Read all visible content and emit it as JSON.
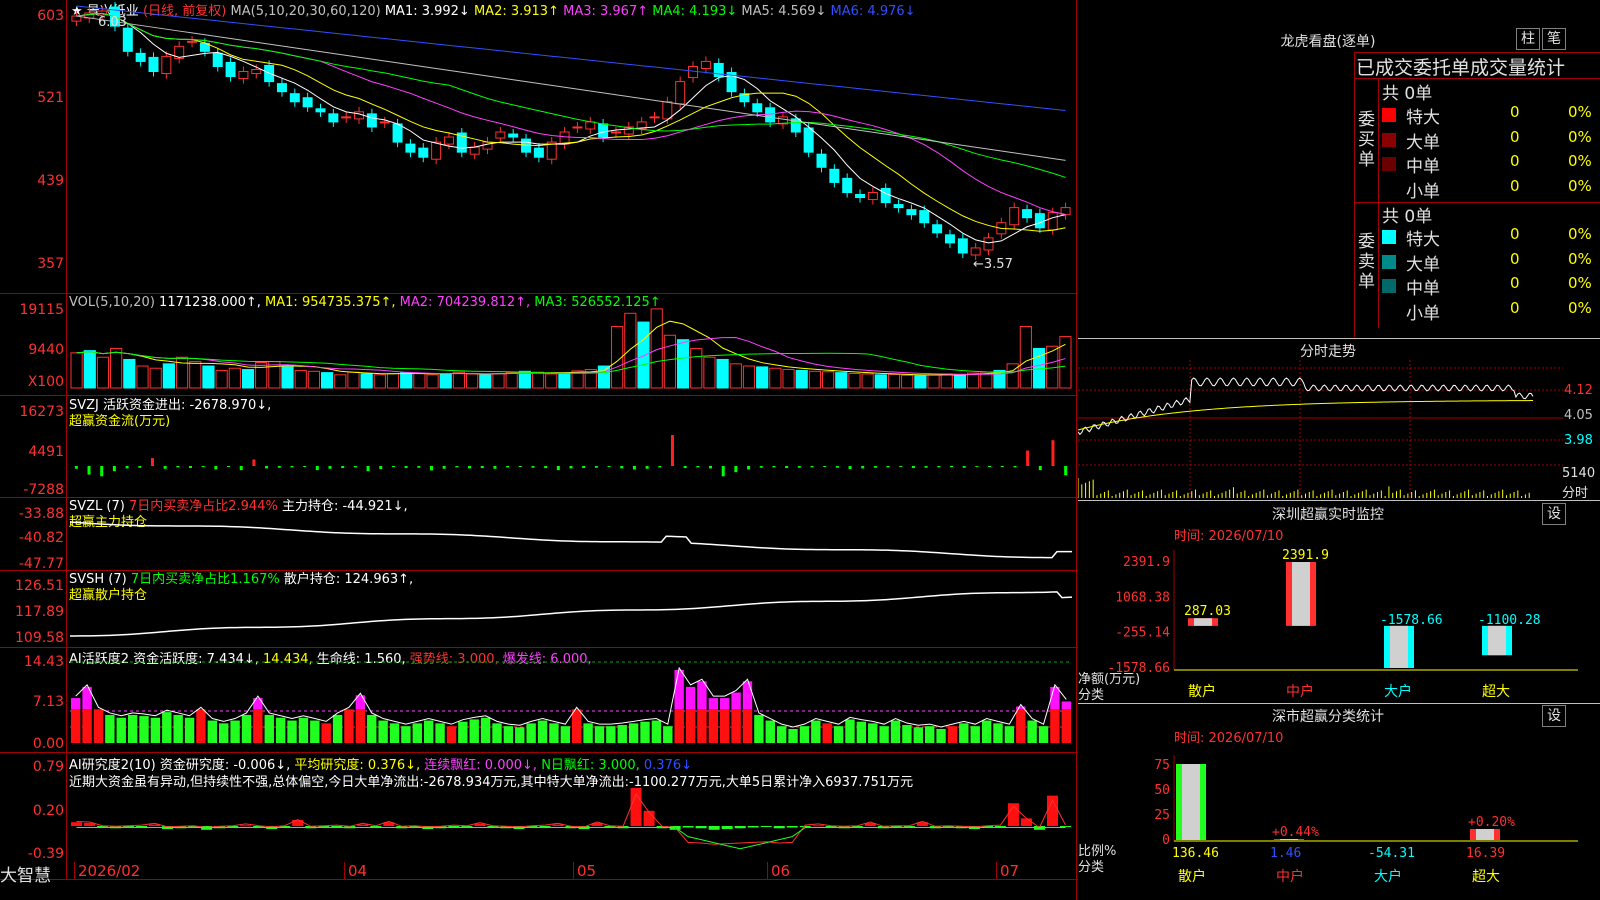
{
  "stock": {
    "star": "★",
    "name": "景兴纸业",
    "period": "(日线, 前复权)"
  },
  "main_header": [
    {
      "text": "MA(5,10,20,30,60,120)",
      "color": "#c0c0c0"
    },
    {
      "text": "MA1: 3.992↓",
      "color": "#ffffff"
    },
    {
      "text": "MA2: 3.913↑",
      "color": "#ffff00"
    },
    {
      "text": "MA3: 3.967↑",
      "color": "#ff40ff"
    },
    {
      "text": "MA4: 4.193↓",
      "color": "#00ff00"
    },
    {
      "text": "MA5: 4.569↓",
      "color": "#c0c0c0"
    },
    {
      "text": "MA6: 4.976↓",
      "color": "#3050ff"
    }
  ],
  "price_annotations": {
    "high": "6.03",
    "low": "←3.57"
  },
  "vol_header": [
    {
      "text": "VOL(5,10,20)",
      "color": "#c0c0c0"
    },
    {
      "text": "1171238.000↑,",
      "color": "#ffffff"
    },
    {
      "text": "MA1: 954735.375↑,",
      "color": "#ffff00"
    },
    {
      "text": "MA2: 704239.812↑,",
      "color": "#ff40ff"
    },
    {
      "text": "MA3: 526552.125↑",
      "color": "#00ff00"
    }
  ],
  "vol_unit": "X100",
  "svzj": {
    "l1": "SVZJ  活跃资金进出: -2678.970↓,",
    "l2": "超赢资金流(万元)"
  },
  "svzl": {
    "l1a": "SVZL (7)",
    "l1b": "7日内买卖净占比2.944%",
    "l1c": "主力持仓: -44.921↓,",
    "l2": "超赢主力持仓"
  },
  "svsh": {
    "l1a": "SVSH (7)",
    "l1b": "7日内买卖净占比1.167%",
    "l1c": "散户持仓: 124.963↑,",
    "l2": "超赢散户持仓"
  },
  "ai1": [
    {
      "text": "AI活跃度2 资金活跃度: 7.434↓,",
      "color": "#ffffff"
    },
    {
      "text": "14.434,",
      "color": "#ffff00"
    },
    {
      "text": "生命线: 1.560,",
      "color": "#ffffff"
    },
    {
      "text": "强势线: 3.000,",
      "color": "#ff3030"
    },
    {
      "text": "爆发线: 6.000,",
      "color": "#ff40ff"
    }
  ],
  "ai2": [
    {
      "text": "AI研究度2(10) 资金研究度: -0.006↓,",
      "color": "#ffffff"
    },
    {
      "text": "平均研究度: 0.376↓,",
      "color": "#ffff00"
    },
    {
      "text": "连续飘红: 0.000↓,",
      "color": "#ff40ff"
    },
    {
      "text": "N日飘红: 3.000,",
      "color": "#00ff00"
    },
    {
      "text": "0.376↓",
      "color": "#3050ff"
    }
  ],
  "ai2_note": "近期大资金虽有异动,但持续性不强,总体偏空,今日大单净流出:-2678.934万元,其中特大单净流出:-1100.277万元,大单5日累计净入6937.751万元",
  "y_labels": {
    "price": [
      "603",
      "521",
      "439",
      "357"
    ],
    "vol": [
      "19115",
      "9440"
    ],
    "svzj": [
      "16273",
      "4491",
      "-7288"
    ],
    "svzl": [
      "-33.88",
      "-40.82",
      "-47.77"
    ],
    "svsh": [
      "126.51",
      "117.89",
      "109.58"
    ],
    "ai1": [
      "14.43",
      "7.13",
      "0.00"
    ],
    "ai2": [
      "0.79",
      "0.20",
      "-0.39"
    ]
  },
  "x_labels": [
    "2026/02",
    "04",
    "05",
    "06",
    "07"
  ],
  "brand": "大智慧",
  "right": {
    "lhkp_title": "龙虎看盘(逐单)",
    "btn_zhu": "柱",
    "btn_bi": "笔",
    "table_title": "已成交委托单成交量统计",
    "buy_label": "委买单",
    "sell_label": "委卖单",
    "buy_total": "共 0单",
    "sell_total": "共 0单",
    "buy_rows": [
      {
        "name": "特大",
        "val": "0",
        "pct": "0%",
        "color": "#ff0000"
      },
      {
        "name": "大单",
        "val": "0",
        "pct": "0%",
        "color": "#8b0000"
      },
      {
        "name": "中单",
        "val": "0",
        "pct": "0%",
        "color": "#6a0000"
      },
      {
        "name": "小单",
        "val": "0",
        "pct": "0%",
        "color": "#000000"
      }
    ],
    "sell_rows": [
      {
        "name": "特大",
        "val": "0",
        "pct": "0%",
        "color": "#00ffff"
      },
      {
        "name": "大单",
        "val": "0",
        "pct": "0%",
        "color": "#008b8b"
      },
      {
        "name": "中单",
        "val": "0",
        "pct": "0%",
        "color": "#006a6a"
      },
      {
        "name": "小单",
        "val": "0",
        "pct": "0%",
        "color": "#000000"
      }
    ],
    "intraday_title": "分时走势",
    "intraday_labels": [
      "4.12",
      "4.05",
      "3.98"
    ],
    "intraday_vol": "5140",
    "intraday_unit": "分时",
    "monitor_title": "深圳超赢实时监控",
    "btn_set": "设",
    "monitor_date": "时间: 2026/07/10",
    "monitor_ylabels": [
      "2391.9",
      "1068.38",
      "-255.14",
      "-1578.66"
    ],
    "monitor_axis": "净额(万元)",
    "monitor_axis2": "分类",
    "cats": [
      "散户",
      "中户",
      "大户",
      "超大"
    ],
    "stat_title": "深市超赢分类统计",
    "stat_date": "时间: 2026/07/10",
    "stat_ylabels": [
      "75",
      "50",
      "25",
      "0"
    ],
    "stat_axis": "比例%",
    "stat_axis2": "分类"
  },
  "chart_data": [
    {
      "type": "candlestick",
      "title": "景兴纸业 (日线, 前复权)",
      "ylim": [
        3.45,
        6.1
      ],
      "ticks": [
        6.03,
        5.21,
        4.39,
        3.57
      ],
      "note": "daily closes sampled left→right",
      "close": [
        5.95,
        5.98,
        6.0,
        5.85,
        5.6,
        5.5,
        5.4,
        5.55,
        5.65,
        5.7,
        5.6,
        5.45,
        5.35,
        5.4,
        5.42,
        5.3,
        5.2,
        5.1,
        5.05,
        5.0,
        4.9,
        4.95,
        5.0,
        4.85,
        4.9,
        4.7,
        4.6,
        4.55,
        4.7,
        4.75,
        4.6,
        4.65,
        4.7,
        4.8,
        4.75,
        4.6,
        4.55,
        4.7,
        4.8,
        4.85,
        4.9,
        4.75,
        4.8,
        4.85,
        4.9,
        4.95,
        5.1,
        5.3,
        5.45,
        5.5,
        5.35,
        5.2,
        5.1,
        5.0,
        4.9,
        4.95,
        4.8,
        4.6,
        4.45,
        4.3,
        4.2,
        4.15,
        4.2,
        4.1,
        4.05,
        3.98,
        3.9,
        3.8,
        3.7,
        3.6,
        3.65,
        3.75,
        3.9,
        4.05,
        3.95,
        3.85,
        4.0,
        4.05
      ]
    },
    {
      "type": "bar",
      "name": "VOL",
      "ylim": [
        0,
        19115
      ],
      "values": [
        8000,
        8500,
        7000,
        9000,
        6500,
        5000,
        4500,
        5500,
        7000,
        6000,
        5000,
        4000,
        4500,
        4200,
        5800,
        6000,
        4800,
        4000,
        3800,
        3500,
        3000,
        3600,
        3200,
        3000,
        3300,
        3500,
        3400,
        3000,
        3100,
        3600,
        3200,
        3000,
        3300,
        3500,
        3800,
        3600,
        3200,
        3400,
        3900,
        4200,
        5000,
        14000,
        17000,
        15000,
        18000,
        12000,
        11000,
        9000,
        7000,
        6500,
        5500,
        5000,
        4800,
        4500,
        4200,
        4000,
        3800,
        3700,
        3500,
        3300,
        3200,
        3000,
        3100,
        2900,
        2800,
        3000,
        3200,
        3100,
        3400,
        3600,
        4000,
        5500,
        14000,
        9000,
        9500,
        11700
      ]
    },
    {
      "type": "bar",
      "name": "SVZJ",
      "ylim": [
        -7288,
        16273
      ],
      "values": [
        -800,
        -2500,
        -3000,
        -1500,
        -700,
        -500,
        2300,
        -800,
        -400,
        -600,
        -300,
        -1000,
        -200,
        -1200,
        1900,
        -700,
        -500,
        -400,
        -200,
        -1200,
        -800,
        -600,
        -400,
        -1500,
        -900,
        -300,
        -600,
        -500,
        -1300,
        -800,
        -400,
        -700,
        -600,
        -800,
        -400,
        -300,
        -500,
        -600,
        -1200,
        -700,
        -600,
        -500,
        -300,
        -700,
        -1000,
        -800,
        -400,
        9000,
        -600,
        -400,
        -700,
        -3000,
        -1800,
        -1000,
        -500,
        -400,
        -600,
        -500,
        -400,
        -300,
        -500,
        -900,
        -700,
        -500,
        -400,
        -300,
        -600,
        -500,
        -400,
        -300,
        -500,
        -200,
        -100,
        -300,
        -400,
        4500,
        -1200,
        7500,
        -2680
      ]
    },
    {
      "type": "line",
      "name": "SVZL",
      "ylim": [
        -47.77,
        -33.88
      ],
      "final": -44.921
    },
    {
      "type": "line",
      "name": "SVSH",
      "ylim": [
        109.58,
        126.51
      ],
      "final": 124.963
    },
    {
      "type": "bar",
      "name": "AI活跃度2",
      "ylim": [
        0,
        14.43
      ],
      "levels": {
        "强势线": 3,
        "爆发线": 6
      },
      "final": 7.434
    },
    {
      "type": "bar",
      "name": "AI研究度2",
      "ylim": [
        -0.39,
        0.79
      ],
      "final": -0.006,
      "avg": 0.376
    },
    {
      "type": "bar",
      "name": "深圳超赢实时监控",
      "categories": [
        "散户",
        "中户",
        "大户",
        "超大"
      ],
      "values": [
        287.03,
        2391.9,
        -1578.66,
        -1100.28
      ],
      "ylim": [
        -1578.66,
        2391.9
      ]
    },
    {
      "type": "bar",
      "name": "深市超赢分类统计",
      "categories": [
        "散户",
        "中户",
        "大户",
        "超大"
      ],
      "values": [
        136.46,
        1.46,
        -54.31,
        16.39
      ],
      "data_labels": [
        "136.46",
        "1.46",
        "-54.31",
        "16.39"
      ],
      "pct_labels": [
        "",
        "+0.44%",
        "",
        "+0.20%"
      ],
      "ylim": [
        0,
        80
      ]
    }
  ]
}
